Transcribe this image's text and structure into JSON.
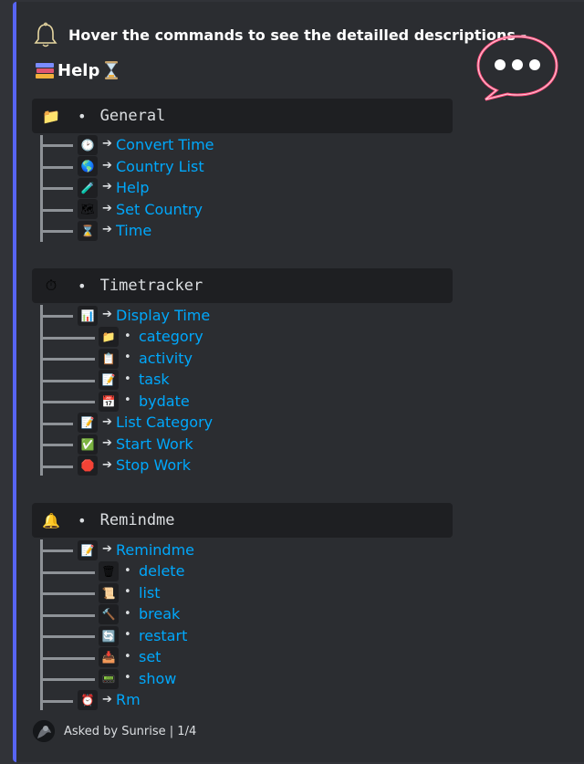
{
  "header": {
    "title": "Hover the commands to see the detailled descriptions -",
    "help_label": "Help",
    "help_icon": "books-icon",
    "hourglass_icon": "hourglass-icon",
    "bell_icon": "bell-outline-icon"
  },
  "sections": {
    "general": {
      "icon": "📁",
      "name": "General",
      "items": [
        {
          "icon": "🕑",
          "label": "Convert Time"
        },
        {
          "icon": "🌎",
          "label": "Country List"
        },
        {
          "icon": "🧪",
          "label": "Help"
        },
        {
          "icon": "🗺",
          "label": "Set Country"
        },
        {
          "icon": "⌛",
          "label": "Time"
        }
      ]
    },
    "timetracker": {
      "icon": "⏱",
      "name": "Timetracker",
      "items": [
        {
          "icon": "📊",
          "label": "Display Time"
        },
        {
          "icon": "📁",
          "label": "category"
        },
        {
          "icon": "📋",
          "label": "activity"
        },
        {
          "icon": "📝",
          "label": "task"
        },
        {
          "icon": "📅",
          "label": "bydate"
        },
        {
          "icon": "📝",
          "label": "List Category"
        },
        {
          "icon": "✅",
          "label": "Start Work"
        },
        {
          "icon": "🛑",
          "label": "Stop Work"
        }
      ]
    },
    "remindme": {
      "icon": "🔔",
      "name": "Remindme",
      "items": [
        {
          "icon": "📝",
          "label": "Remindme"
        },
        {
          "icon": "🗑",
          "label": "delete"
        },
        {
          "icon": "📜",
          "label": "list"
        },
        {
          "icon": "🔨",
          "label": "break"
        },
        {
          "icon": "🔄",
          "label": "restart"
        },
        {
          "icon": "📥",
          "label": "set"
        },
        {
          "icon": "📟",
          "label": "show"
        },
        {
          "icon": "⏰",
          "label": "Rm"
        }
      ]
    }
  },
  "separators": {
    "arrow": "➔",
    "bullet": "•",
    "dot": "•"
  },
  "footer": {
    "text": "Asked by Sunrise | 1/4"
  },
  "colors": {
    "accent": "#5865f2",
    "link": "#00a8fc",
    "embed_bg": "#2b2d31",
    "code_bg": "#1e1f22",
    "neon": "#ff4d7d"
  }
}
